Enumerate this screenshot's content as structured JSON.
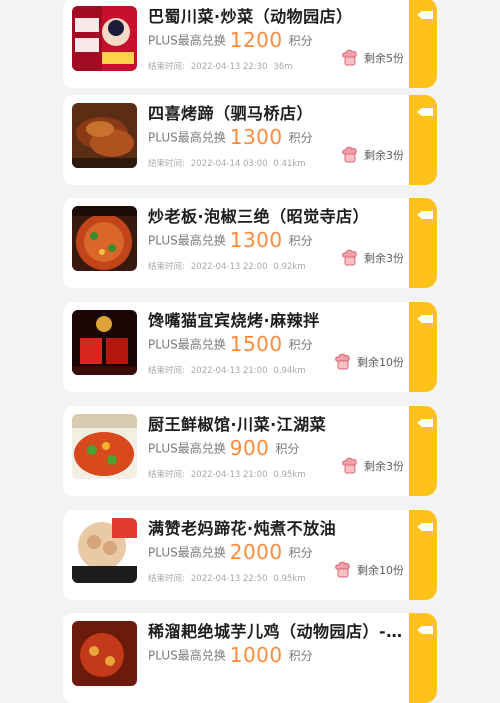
{
  "plus_label": "PLUS最高兑换",
  "unit_label": "积分",
  "end_prefix": "结束时间:",
  "items": [
    {
      "title": "巴蜀川菜·炒菜（动物园店）",
      "price": "1200",
      "end_time": "2022-04-13 22:30",
      "distance": "36m",
      "remain": "剩余5份"
    },
    {
      "title": "四喜烤蹄（驷马桥店）",
      "price": "1300",
      "end_time": "2022-04-14 03:00",
      "distance": "0.41km",
      "remain": "剩余3份"
    },
    {
      "title": "炒老板·泡椒三绝（昭觉寺店）",
      "price": "1300",
      "end_time": "2022-04-13 22:00",
      "distance": "0.92km",
      "remain": "剩余3份"
    },
    {
      "title": "馋嘴猫宜宾烧烤·麻辣拌",
      "price": "1500",
      "end_time": "2022-04-13 21:00",
      "distance": "0.94km",
      "remain": "剩余10份"
    },
    {
      "title": "厨王鲜椒馆·川菜·江湖菜",
      "price": "900",
      "end_time": "2022-04-13 21:00",
      "distance": "0.95km",
      "remain": "剩余3份"
    },
    {
      "title": "满赞老妈蹄花·炖煮不放油",
      "price": "2000",
      "end_time": "2022-04-13 22:50",
      "distance": "0.95km",
      "remain": "剩余10份"
    },
    {
      "title": "稀溜耙绝城芋儿鸡（动物园店）-...",
      "price": "1000",
      "end_time": "",
      "distance": "",
      "remain": ""
    }
  ],
  "colors": {
    "accent": "#ff8a3d",
    "tab": "#ffc21a"
  }
}
